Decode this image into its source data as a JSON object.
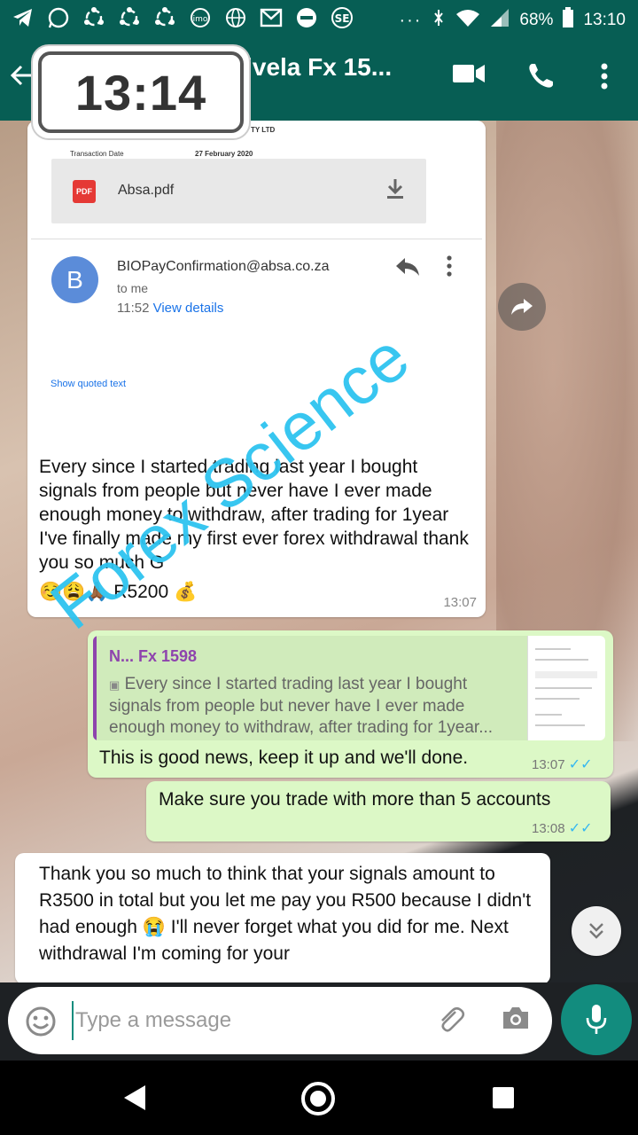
{
  "status_bar": {
    "battery": "68%",
    "time": "13:10",
    "icons": [
      "telegram-icon",
      "whatsapp-icon",
      "sync-icon",
      "sync-icon",
      "sync-icon",
      "imo-icon",
      "globe-icon",
      "mail-icon",
      "dnd-icon",
      "se-icon",
      "more-dots-icon",
      "wifi-icon",
      "signal-icon",
      "battery-icon"
    ]
  },
  "header": {
    "title": "nivela Fx 15..."
  },
  "timestamp_overlay": "13:14",
  "messages": {
    "incoming_1": {
      "attachment": {
        "transaction_date_label": "Transaction Date",
        "transaction_date": "27 February 2020",
        "company_fragment": "TY LTD",
        "file_badge": "PDF",
        "file_name": "Absa.pdf"
      },
      "email": {
        "avatar_letter": "B",
        "from": "BIOPayConfirmation@absa.co.za",
        "to": "to me",
        "time": "11:52",
        "details_link": "View details",
        "quoted_link": "Show quoted text"
      },
      "text": "Every since I started trading last year I bought signals from people but never have I ever made enough money to withdraw, after trading for 1year I've finally made my first ever forex withdrawal thank you so much G",
      "text_tail": "☺️😩🙏🏾 R5200 💰",
      "time": "13:07"
    },
    "outgoing_1": {
      "quote_name": "N... Fx 1598",
      "quote_text": "Every since I started trading last year I bought signals from people but never have I ever made enough money to withdraw, after trading for 1year...",
      "text": "This is good news, keep it up and we'll done.",
      "time": "13:07"
    },
    "outgoing_2": {
      "text": "Make sure you trade with more than 5 accounts",
      "time": "13:08"
    },
    "incoming_2": {
      "text": "Thank you so much to think that your signals amount to R3500 in total but you let me pay you R500 because I didn't had enough 😭 I'll never forget what you did for me. Next withdrawal I'm coming for your"
    }
  },
  "watermark": "Forex Science",
  "input": {
    "placeholder": "Type a message"
  },
  "colors": {
    "header": "#075e54",
    "outgoing_bubble": "#dcf8c6",
    "mic_button": "#128c7e",
    "read_ticks": "#34b7f1",
    "watermark": "#2ec4f0"
  }
}
